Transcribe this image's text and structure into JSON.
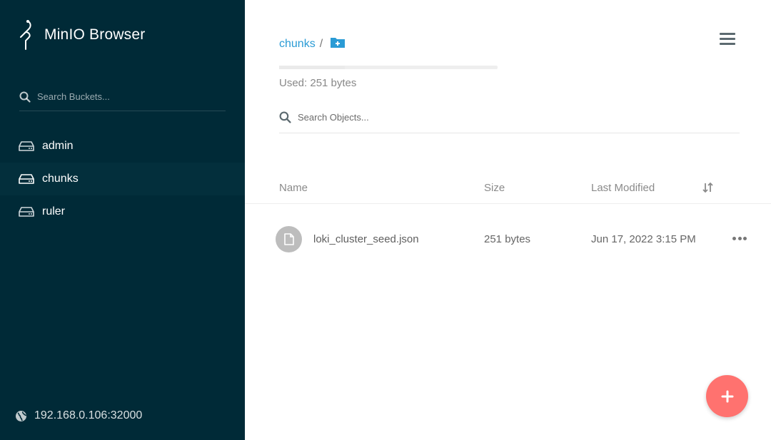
{
  "app": {
    "title": "MinIO Browser"
  },
  "sidebar": {
    "search_placeholder": "Search Buckets...",
    "buckets": [
      {
        "label": "admin",
        "active": false
      },
      {
        "label": "chunks",
        "active": true
      },
      {
        "label": "ruler",
        "active": false
      }
    ],
    "host": "192.168.0.106:32000"
  },
  "main": {
    "breadcrumb": {
      "bucket": "chunks",
      "separator": "/"
    },
    "usage": {
      "text": "Used: 251 bytes"
    },
    "search_placeholder": "Search Objects...",
    "table": {
      "columns": {
        "name": "Name",
        "size": "Size",
        "modified": "Last Modified"
      },
      "rows": [
        {
          "name": "loki_cluster_seed.json",
          "size": "251 bytes",
          "modified": "Jun 17, 2022 3:15 PM"
        }
      ]
    }
  },
  "icons": {
    "logo": "minio-logo-icon",
    "search": "search-icon",
    "bucket": "drive-icon",
    "globe": "globe-icon",
    "new_folder": "folder-plus-icon",
    "menu": "hamburger-menu-icon",
    "sort": "sort-icon",
    "file": "file-icon",
    "more": "more-horizontal-icon",
    "add": "plus-icon"
  },
  "colors": {
    "sidebar_bg": "#002a37",
    "link": "#2a9bd5",
    "fab": "#ff726f"
  }
}
